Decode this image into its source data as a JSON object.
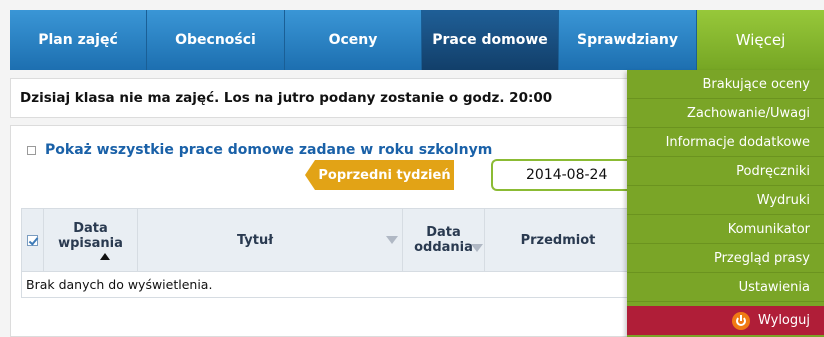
{
  "nav": {
    "tabs": [
      {
        "label": "Plan zajęć"
      },
      {
        "label": "Obecności"
      },
      {
        "label": "Oceny"
      },
      {
        "label": "Prace domowe"
      },
      {
        "label": "Sprawdziany"
      },
      {
        "label": "Więcej"
      }
    ],
    "active_tab": "Prace domowe"
  },
  "info": {
    "message": "Dzisiaj klasa nie ma zajęć. Los na jutro podany zostanie o godz. 20:00"
  },
  "homework": {
    "show_all_label": "Pokaż wszystkie prace domowe zadane w roku szkolnym",
    "show_all_checked": false,
    "prev_week_label": "Poprzedni tydzień",
    "date_value": "2014-08-24",
    "table": {
      "columns": [
        {
          "label": "Data wpisania",
          "sort": "ascending"
        },
        {
          "label": "Tytuł"
        },
        {
          "label": "Data oddania"
        },
        {
          "label": "Przedmiot"
        }
      ],
      "empty_message": "Brak danych do wyświetlenia."
    }
  },
  "more_menu": {
    "items": [
      {
        "label": "Brakujące oceny"
      },
      {
        "label": "Zachowanie/Uwagi"
      },
      {
        "label": "Informacje dodatkowe"
      },
      {
        "label": "Podręczniki"
      },
      {
        "label": "Wydruki"
      },
      {
        "label": "Komunikator"
      },
      {
        "label": "Przegląd prasy"
      },
      {
        "label": "Ustawienia"
      }
    ],
    "logout_label": "Wyloguj"
  },
  "colors": {
    "nav_blue": "#1d6fb0",
    "nav_active": "#123f6a",
    "menu_green": "#7aa527",
    "prev_week_orange": "#e2a316",
    "logout_red": "#b01e38"
  }
}
